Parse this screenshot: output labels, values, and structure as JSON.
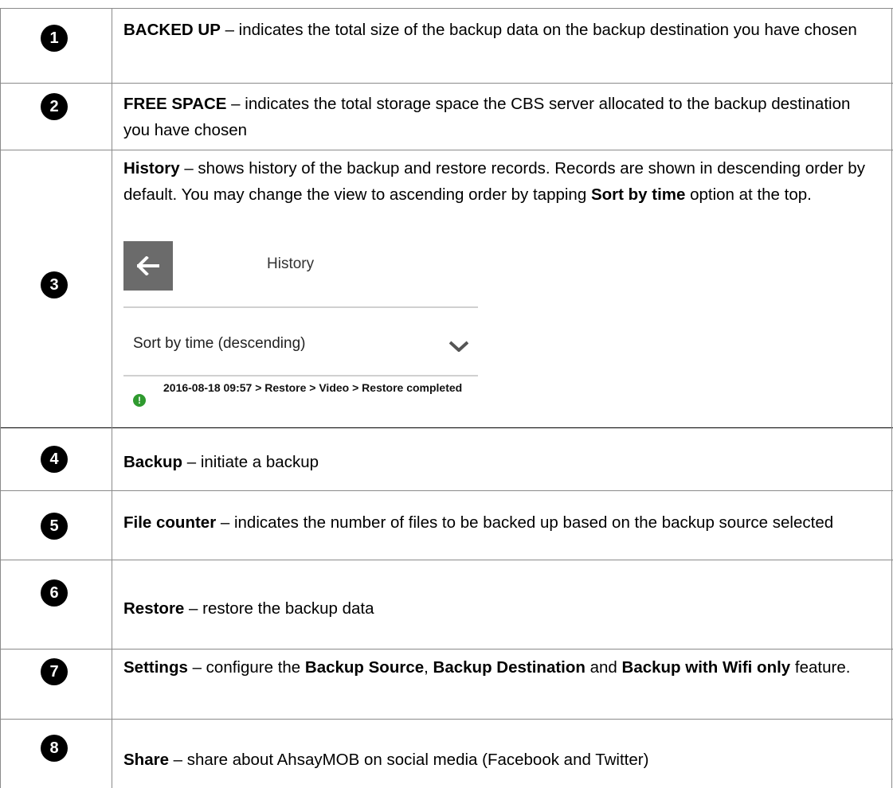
{
  "rows": [
    {
      "num": "1",
      "bold": "BACKED UP",
      "text": " – indicates the total size of the backup data on the backup destination you have chosen"
    },
    {
      "num": "2",
      "bold": "FREE SPACE",
      "text": " – indicates the total storage space the CBS server allocated to the backup destination you have chosen"
    },
    {
      "num": "3",
      "bold": "History",
      "text": " – shows history of the backup and restore records. Records are shown in descending order by default. You may change the view to ascending order by tapping ",
      "bold2": "Sort by time",
      "text2": " option at the top."
    },
    {
      "num": "4",
      "bold": "Backup",
      "text": " – initiate a backup"
    },
    {
      "num": "5",
      "bold": "File counter",
      "text": " – indicates the number of files to be backed up based on the backup source selected"
    },
    {
      "num": "6",
      "bold": "Restore",
      "text": " – restore the backup data"
    },
    {
      "num": "7",
      "bold": "Settings",
      "text": " – configure the ",
      "bold2": "Backup Source",
      "text2": ", ",
      "bold3": "Backup Destination",
      "text3": " and ",
      "bold4": "Backup with Wifi only",
      "text4": " feature."
    },
    {
      "num": "8",
      "bold": "Share",
      "text": " – share about AhsayMOB on social media (Facebook and Twitter)"
    }
  ],
  "history_screen": {
    "title": "History",
    "sort_label": "Sort by time (descending)",
    "entry": "2016-08-18 09:57 > Restore > Video > Restore completed",
    "back_icon": "arrow-left-icon",
    "chevron_icon": "chevron-down-icon",
    "status_icon": "info-icon",
    "status_color": "#2f9a2f"
  }
}
